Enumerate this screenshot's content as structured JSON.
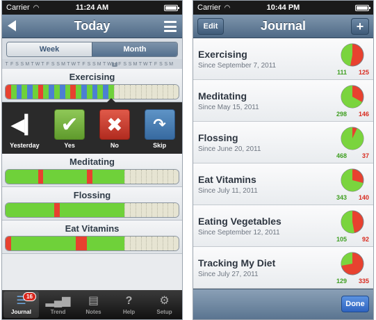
{
  "left": {
    "status": {
      "carrier": "Carrier",
      "time": "11:24 AM"
    },
    "nav": {
      "title": "Today"
    },
    "segments": {
      "week": "Week",
      "month": "Month"
    },
    "days": [
      "T",
      "F",
      "S",
      "S",
      "M",
      "T",
      "W",
      "T",
      "F",
      "S",
      "S",
      "M",
      "T",
      "W",
      "T",
      "F",
      "S",
      "S",
      "M",
      "T",
      "W",
      "T",
      "F",
      "S",
      "S",
      "M",
      "T",
      "W",
      "T",
      "F",
      "S",
      "S",
      "M"
    ],
    "current_day_index": 21,
    "habits": [
      {
        "name": "Exercising",
        "segments": "RGBGBGRGBGBGRGBGBGBGXXXXXXXXXXXX"
      },
      {
        "name": "Meditating",
        "segments": "GGGGGGRGGGGGGGGRGGGGGGXXXXXXXXXX"
      },
      {
        "name": "Flossing",
        "segments": "GGGGGGGGGRGGGGGGGGGGGGXXXXXXXXXX"
      },
      {
        "name": "Eat Vitamins",
        "segments": "RGGGGGGGGGGGGRRGGGGGGGXXXXXXXXXX"
      }
    ],
    "actions": {
      "yesterday": "Yesterday",
      "yes": "Yes",
      "no": "No",
      "skip": "Skip"
    },
    "tabs": {
      "journal": "Journal",
      "trend": "Trend",
      "notes": "Notes",
      "help": "Help",
      "setup": "Setup",
      "badge": "16"
    },
    "colors": {
      "green": "#6fd13a",
      "red": "#e8412f",
      "blue": "#4c7fd3",
      "empty": "#e6e4d2"
    }
  },
  "right": {
    "status": {
      "carrier": "Carrier",
      "time": "10:44 PM"
    },
    "nav": {
      "title": "Journal",
      "edit": "Edit",
      "add": "+"
    },
    "rows": [
      {
        "name": "Exercising",
        "since": "Since September 7, 2011",
        "green": "111",
        "red": "125",
        "fraction": 0.47
      },
      {
        "name": "Meditating",
        "since": "Since May 15, 2011",
        "green": "298",
        "red": "146",
        "fraction": 0.67
      },
      {
        "name": "Flossing",
        "since": "Since June 20, 2011",
        "green": "468",
        "red": "37",
        "fraction": 0.93
      },
      {
        "name": "Eat Vitamins",
        "since": "Since July 11, 2011",
        "green": "343",
        "red": "140",
        "fraction": 0.71
      },
      {
        "name": "Eating Vegetables",
        "since": "Since September 12, 2011",
        "green": "105",
        "red": "92",
        "fraction": 0.53
      },
      {
        "name": "Tracking My Diet",
        "since": "Since July 27, 2011",
        "green": "129",
        "red": "335",
        "fraction": 0.28
      }
    ],
    "done": "Done"
  }
}
